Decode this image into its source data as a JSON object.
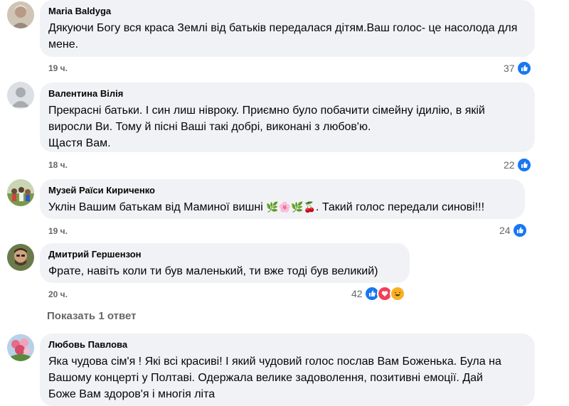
{
  "comments": [
    {
      "author": "Maria Baldyga",
      "text": "Дякуючи Богу вся краса Землі від батьків передалася дітям.Ваш голос- це насолода для мене.",
      "time": "19 ч.",
      "reactions": "37"
    },
    {
      "author": "Валентина Вілія",
      "text": "Прекрасні батьки. І син лиш нівроку. Приємно було побачити сімейну ідилію, в якій виросли Ви. Тому й пісні Ваші такі добрі, виконані з любов'ю.",
      "text2": "Щастя Вам.",
      "time": "18 ч.",
      "reactions": "22"
    },
    {
      "author": "Музей Раїси Кириченко",
      "text_before": "Уклін Вашим батькам від Маминої вишні",
      "emoji": "🌿🌸🌿🍒",
      "text_after": ". Такий голос передали синові!!!",
      "time": "19 ч.",
      "reactions": "24"
    },
    {
      "author": "Дмитрий Гершензон",
      "text": "Фрате, навіть коли ти був маленький, ти вже тоді був великий)",
      "time": "20 ч.",
      "reactions": "42"
    },
    {
      "author": "Любовь Павлова",
      "text": "Яка чудова сім'я ! Які всі красиві! І який чудовий голос послав Вам Боженька. Була на Вашому концерті у Полтаві. Одержала велике задоволення, позитивні емоції. Дай Боже Вам здоров'я і многія літа"
    }
  ],
  "show_replies": {
    "prefix": "Показать ",
    "count": "1",
    "suffix": " ответ"
  },
  "colors": {
    "bubble": "#f0f2f5",
    "meta": "#65676b",
    "like": "#1877f2",
    "love": "#f33e58",
    "haha": "#f7b125"
  },
  "icons": [
    "like-icon",
    "love-icon",
    "haha-icon"
  ]
}
